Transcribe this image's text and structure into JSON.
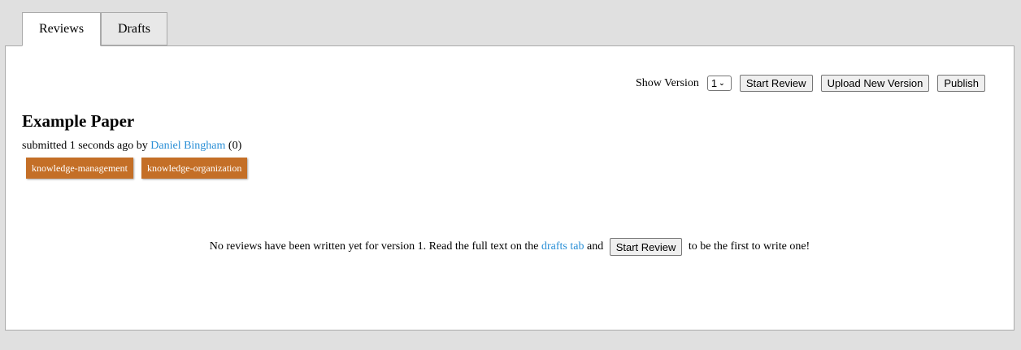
{
  "tabs": [
    {
      "label": "Reviews",
      "active": true
    },
    {
      "label": "Drafts",
      "active": false
    }
  ],
  "toolbar": {
    "show_version_label": "Show Version",
    "version_value": "1",
    "start_review": "Start Review",
    "upload_new_version": "Upload New Version",
    "publish": "Publish"
  },
  "paper": {
    "title": "Example Paper",
    "submitted": "submitted 1 seconds ago",
    "by": "by",
    "author": "Daniel Bingham",
    "score": "(0)",
    "tags": [
      "knowledge-management",
      "knowledge-organization"
    ]
  },
  "empty_state": {
    "text_before": "No reviews have been written yet for version 1. Read the full text on the ",
    "drafts_link": "drafts tab",
    "text_and": " and ",
    "start_review": "Start Review",
    "text_after": " to be the first to write one!"
  },
  "colors": {
    "link": "#2a8fd6",
    "tag_bg": "#c46f27",
    "page_bg": "#e0e0e0"
  }
}
